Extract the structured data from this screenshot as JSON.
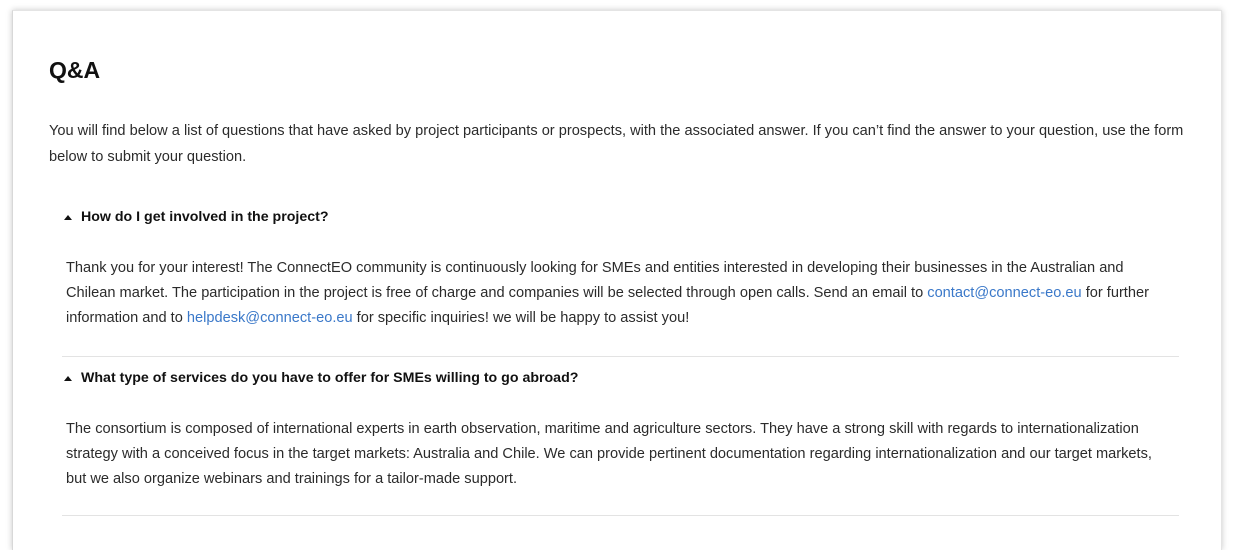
{
  "page": {
    "title": "Q&A",
    "intro": "You will find below a list of questions that have asked by project participants or prospects, with the associated answer. If you can’t find the answer to your question, use the form below to submit your question."
  },
  "faq": [
    {
      "question": "How do I get involved in the project?",
      "answer_part1": "Thank you for your interest! The ConnectEO community is continuously looking for SMEs and entities interested in developing their businesses in the Australian and Chilean market. The participation in the project is free of charge and companies will be selected through open calls. Send an email to ",
      "link1": "contact@connect-eo.eu",
      "answer_part2": " for further information and to ",
      "link2": "helpdesk@connect-eo.eu",
      "answer_part3": " for specific inquiries! we will be happy to assist you!"
    },
    {
      "question": "What type of services do you have to offer for SMEs willing to go abroad?",
      "answer": "The consortium is composed of international experts in earth observation, maritime and agriculture sectors. They have a strong skill with regards to internationalization strategy with a conceived focus in the target markets: Australia and Chile. We can provide pertinent documentation regarding internationalization and our target markets, but we also organize webinars and trainings for a tailor-made support."
    }
  ],
  "colors": {
    "link": "#3a78c9",
    "text": "#2b2b2b",
    "heading": "#111111",
    "divider": "#e3e3e3"
  },
  "icons": {
    "expand_indicator": "caret-up-icon"
  }
}
